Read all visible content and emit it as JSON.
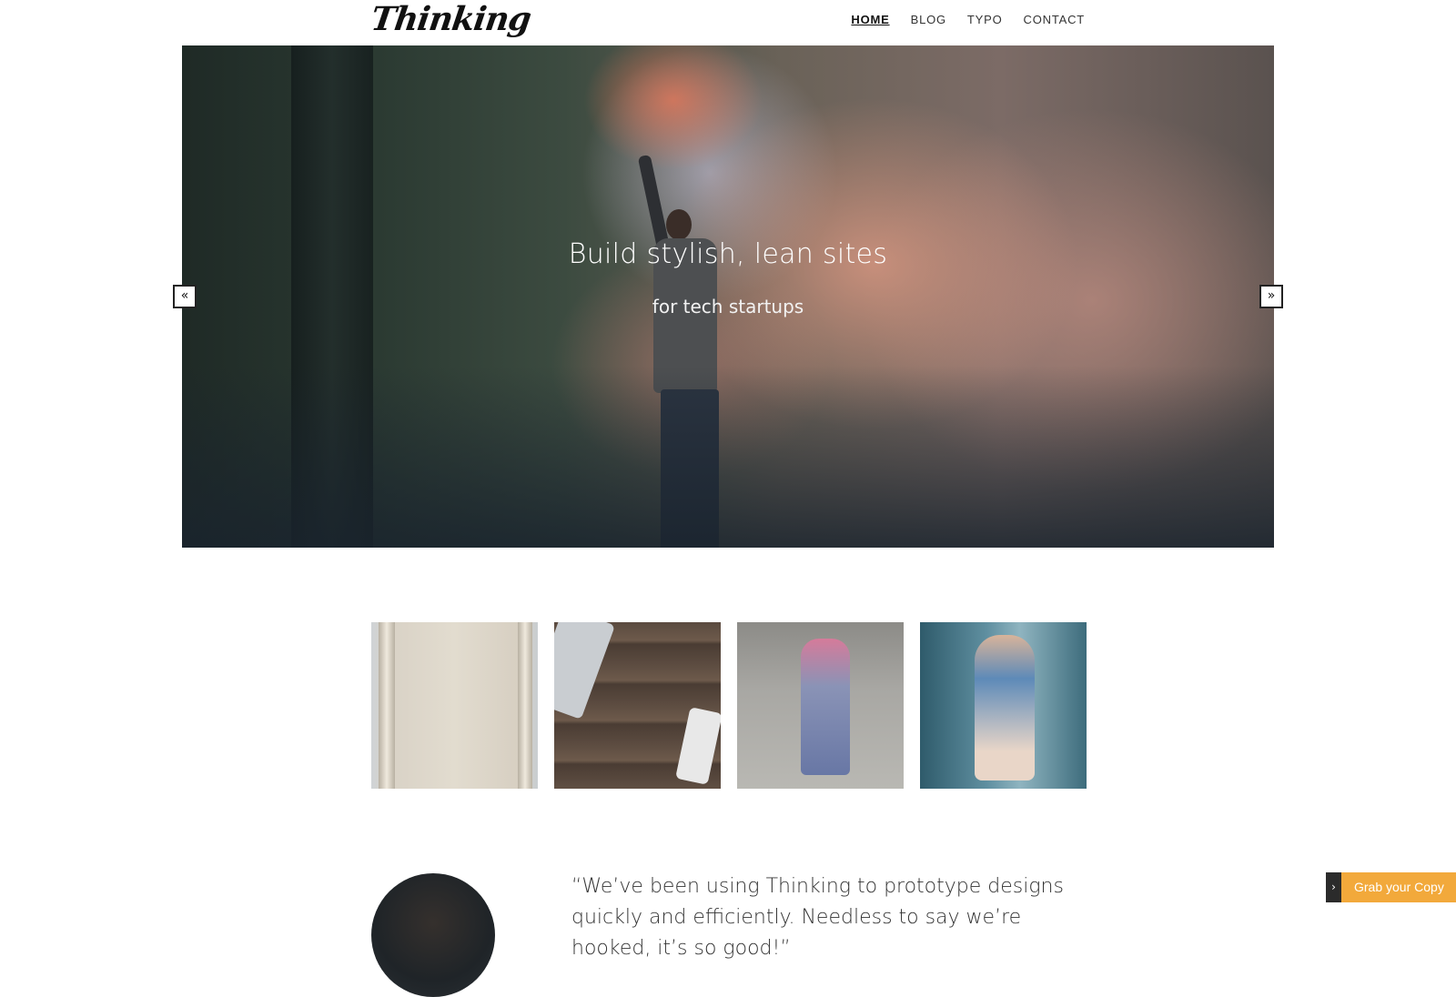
{
  "header": {
    "logo_text": "Thinking",
    "nav": [
      {
        "label": "HOME",
        "active": true
      },
      {
        "label": "BLOG",
        "active": false
      },
      {
        "label": "TYPO",
        "active": false
      },
      {
        "label": "CONTACT",
        "active": false
      }
    ]
  },
  "hero": {
    "title": "Build stylish, lean sites",
    "subtitle": "for tech startups",
    "prev_label": "«",
    "next_label": "»"
  },
  "gallery": {
    "items": [
      {
        "icon": "paper-roll-photo"
      },
      {
        "icon": "desk-laptop-earphones-photo"
      },
      {
        "icon": "woman-pink-hair-photo"
      },
      {
        "icon": "woman-denim-jacket-photo"
      }
    ]
  },
  "testimonial": {
    "quote": "“We’ve been using Thinking to prototype designs quickly and efficiently. Needless to say we’re hooked, it’s so good!”"
  },
  "grab": {
    "arrow_label": "›",
    "button_label": "Grab your Copy",
    "accent_color": "#f2a93b"
  }
}
